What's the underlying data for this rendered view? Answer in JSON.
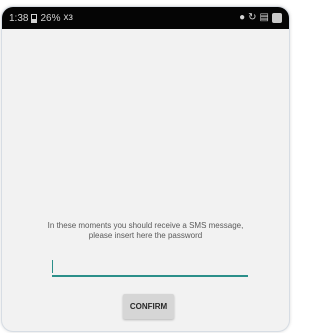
{
  "status_bar": {
    "time": "1:38",
    "battery": "26%",
    "signal_glyph": "хз",
    "icons": [
      "battery-icon",
      "alarm-icon",
      "sync-icon",
      "signal-icon",
      "app-icon"
    ]
  },
  "sms_verification": {
    "message_line1": "In these moments you should receive a SMS message,",
    "message_line2": "please insert here the password",
    "password_value": "",
    "confirm_label": "CONFIRM"
  },
  "colors": {
    "accent": "#2b8f8a",
    "background": "#f2f2f2",
    "status_bar": "#050505",
    "button": "#d6d6d6"
  }
}
